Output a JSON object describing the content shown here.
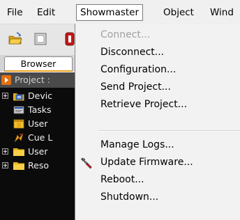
{
  "menubar": {
    "items": [
      {
        "label": "File"
      },
      {
        "label": "Edit"
      },
      {
        "label": "Showmaster",
        "active": true
      },
      {
        "label": "Object"
      },
      {
        "label": "Wind"
      }
    ]
  },
  "toolbar": {
    "icons": [
      "open-folder-icon",
      "stop-icon",
      "red-record-icon"
    ]
  },
  "tab": {
    "label": "Browser"
  },
  "tree": {
    "project_label": "Project :",
    "rows": [
      {
        "label": "Devic",
        "icon": "devices-icon",
        "expandable": true
      },
      {
        "label": "Tasks",
        "icon": "tasks-icon",
        "expandable": false
      },
      {
        "label": "User",
        "icon": "user-icon",
        "expandable": false
      },
      {
        "label": "Cue L",
        "icon": "cue-list-icon",
        "expandable": false
      },
      {
        "label": "User",
        "icon": "folder-icon",
        "expandable": true
      },
      {
        "label": "Reso",
        "icon": "folder-icon",
        "expandable": true
      }
    ]
  },
  "dropdown": {
    "items": [
      {
        "label": "Connect...",
        "enabled": false
      },
      {
        "label": "Disconnect...",
        "enabled": true
      },
      {
        "label": "Configuration...",
        "enabled": true
      },
      {
        "label": "Send Project...",
        "enabled": true
      },
      {
        "label": "Retrieve Project...",
        "enabled": true
      },
      {
        "label": "Manage Logs...",
        "enabled": true
      },
      {
        "label": "Update Firmware...",
        "enabled": true,
        "icon": "wrench-icon"
      },
      {
        "label": "Reboot...",
        "enabled": true
      },
      {
        "label": "Shutdown...",
        "enabled": true
      }
    ]
  },
  "colors": {
    "menubar_bg": "#f0f0f0",
    "tree_bg": "#0b0b0b",
    "project_row_bg": "#4a4a4a",
    "project_icon": "#e07010",
    "folder_yellow": "#f0c020",
    "disabled_text": "#a0a0a0"
  }
}
